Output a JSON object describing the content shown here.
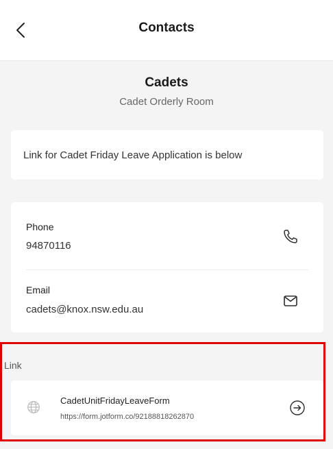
{
  "header": {
    "title": "Contacts"
  },
  "group": {
    "name": "Cadets",
    "subtitle": "Cadet Orderly Room"
  },
  "notice": {
    "text": "Link for Cadet Friday Leave Application is below"
  },
  "contacts": {
    "phone": {
      "label": "Phone",
      "value": "94870116"
    },
    "email": {
      "label": "Email",
      "value": "cadets@knox.nsw.edu.au"
    }
  },
  "link_section": {
    "label": "Link",
    "title": "CadetUnitFridayLeaveForm",
    "url": "https://form.jotform.co/92188818262870"
  },
  "icons": {
    "back": "chevron-left-icon",
    "phone": "phone-icon",
    "email": "envelope-icon",
    "globe": "globe-icon",
    "open_link": "arrow-right-circle-icon"
  },
  "colors": {
    "highlight": "#e00000",
    "background": "#f4f4f4",
    "card": "#ffffff"
  }
}
